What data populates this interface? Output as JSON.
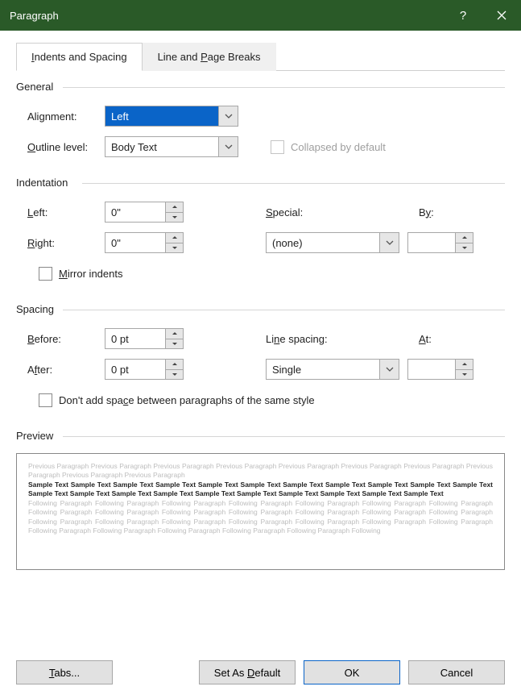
{
  "title": "Paragraph",
  "tabs": {
    "indents": "Indents and Spacing",
    "breaks": "Line and Page Breaks"
  },
  "general": {
    "heading": "General",
    "alignment_label": "Alignment:",
    "alignment_value": "Left",
    "outline_label": "Outline level:",
    "outline_value": "Body Text",
    "collapsed_label": "Collapsed by default"
  },
  "indentation": {
    "heading": "Indentation",
    "left_label": "Left:",
    "left_value": "0\"",
    "right_label": "Right:",
    "right_value": "0\"",
    "special_label": "Special:",
    "special_value": "(none)",
    "by_label": "By:",
    "by_value": "",
    "mirror_label": "Mirror indents"
  },
  "spacing": {
    "heading": "Spacing",
    "before_label": "Before:",
    "before_value": "0 pt",
    "after_label": "After:",
    "after_value": "0 pt",
    "linespacing_label": "Line spacing:",
    "linespacing_value": "Single",
    "at_label": "At:",
    "at_value": "",
    "dontadd_label": "Don't add space between paragraphs of the same style"
  },
  "preview": {
    "heading": "Preview",
    "prev_text": "Previous Paragraph Previous Paragraph Previous Paragraph Previous Paragraph Previous Paragraph Previous Paragraph Previous Paragraph Previous Paragraph Previous Paragraph Previous Paragraph",
    "sample_text": "Sample Text Sample Text Sample Text Sample Text Sample Text Sample Text Sample Text Sample Text Sample Text Sample Text Sample Text Sample Text Sample Text Sample Text Sample Text Sample Text Sample Text Sample Text Sample Text Sample Text Sample Text",
    "follow_text": "Following Paragraph Following Paragraph Following Paragraph Following Paragraph Following Paragraph Following Paragraph Following Paragraph Following Paragraph Following Paragraph Following Paragraph Following Paragraph Following Paragraph Following Paragraph Following Paragraph Following Paragraph Following Paragraph Following Paragraph Following Paragraph Following Paragraph Following Paragraph Following Paragraph Following Paragraph Following Paragraph Following Paragraph Following Paragraph Following Paragraph Following"
  },
  "buttons": {
    "tabs": "Tabs...",
    "setdefault": "Set As Default",
    "ok": "OK",
    "cancel": "Cancel"
  }
}
